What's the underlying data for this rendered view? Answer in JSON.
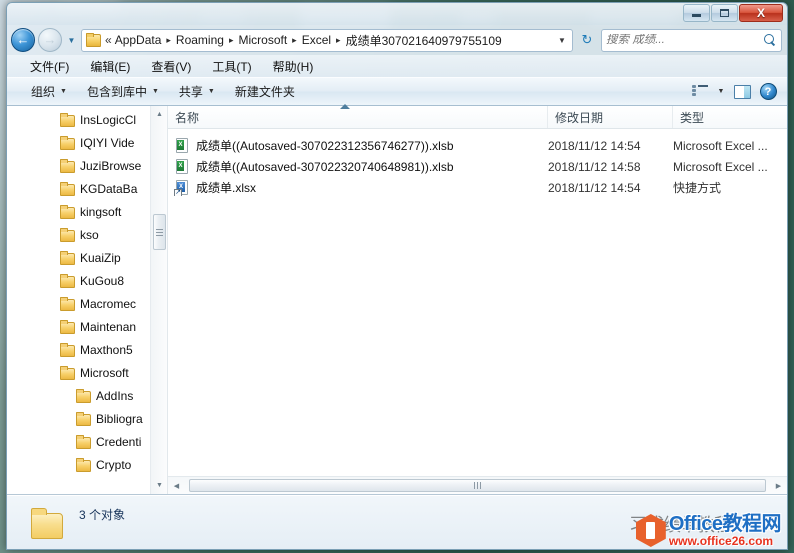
{
  "window": {
    "controls": {
      "minimize": "–",
      "maximize": "□",
      "close": "X"
    }
  },
  "address": {
    "back_label": "←",
    "forward_label": "→",
    "history_caret": "▼",
    "folder_icon": "folder-icon",
    "ellipsis": "«",
    "crumbs": [
      {
        "label": "AppData"
      },
      {
        "label": "Roaming"
      },
      {
        "label": "Microsoft"
      },
      {
        "label": "Excel"
      },
      {
        "label": "成绩单307021640979755109"
      }
    ],
    "separator": "▸",
    "dropdown_caret": "▼",
    "refresh_label": "↻"
  },
  "search": {
    "value": "",
    "placeholder": "搜索 成绩..."
  },
  "menubar": {
    "items": [
      {
        "label": "文件(F)"
      },
      {
        "label": "编辑(E)"
      },
      {
        "label": "查看(V)"
      },
      {
        "label": "工具(T)"
      },
      {
        "label": "帮助(H)"
      }
    ]
  },
  "toolbar": {
    "organize_label": "组织",
    "include_library_label": "包含到库中",
    "share_label": "共享",
    "new_folder_label": "新建文件夹",
    "caret": "▼",
    "view_caret": "▼",
    "help_glyph": "?"
  },
  "navpane": {
    "items": [
      {
        "label": "InsLogicCl",
        "level": 1
      },
      {
        "label": "IQIYI Vide",
        "level": 1
      },
      {
        "label": "JuziBrowse",
        "level": 1
      },
      {
        "label": "KGDataBa",
        "level": 1
      },
      {
        "label": "kingsoft",
        "level": 1
      },
      {
        "label": "kso",
        "level": 1
      },
      {
        "label": "KuaiZip",
        "level": 1
      },
      {
        "label": "KuGou8",
        "level": 1
      },
      {
        "label": "Macromec",
        "level": 1
      },
      {
        "label": "Maintenan",
        "level": 1
      },
      {
        "label": "Maxthon5",
        "level": 1
      },
      {
        "label": "Microsoft",
        "level": 1
      },
      {
        "label": "AddIns",
        "level": 2
      },
      {
        "label": "Bibliogra",
        "level": 2
      },
      {
        "label": "Credenti",
        "level": 2
      },
      {
        "label": "Crypto",
        "level": 2
      }
    ],
    "scroll_up": "▲",
    "scroll_down": "▼"
  },
  "filelist": {
    "columns": {
      "name": "名称",
      "date": "修改日期",
      "type": "类型"
    },
    "rows": [
      {
        "name": "成绩单((Autosaved-307022312356746277)).xlsb",
        "date": "2018/11/12 14:54",
        "type": "Microsoft Excel ...",
        "icon": "excel-xlsb-icon",
        "icon_letter": "X"
      },
      {
        "name": "成绩单((Autosaved-307022320740648981)).xlsb",
        "date": "2018/11/12 14:58",
        "type": "Microsoft Excel ...",
        "icon": "excel-xlsb-icon",
        "icon_letter": "X"
      },
      {
        "name": "成绩单.xlsx",
        "date": "2018/11/12 14:54",
        "type": "快捷方式",
        "icon": "shortcut-icon",
        "icon_letter": "X",
        "shortcut_glyph": "↗"
      }
    ],
    "scroll_left": "◀",
    "scroll_right": "▶"
  },
  "statusbar": {
    "item_count_text": "3 个对象"
  },
  "watermark": {
    "ghost_text": "习成绩单教程",
    "title": "Office教程网",
    "url": "www.office26.com"
  },
  "colors": {
    "accent": "#1f6fc4",
    "close_button": "#b8301c",
    "watermark_orange": "#e8612c",
    "watermark_red": "#e8331f",
    "folder_yellow": "#f3cd63"
  }
}
